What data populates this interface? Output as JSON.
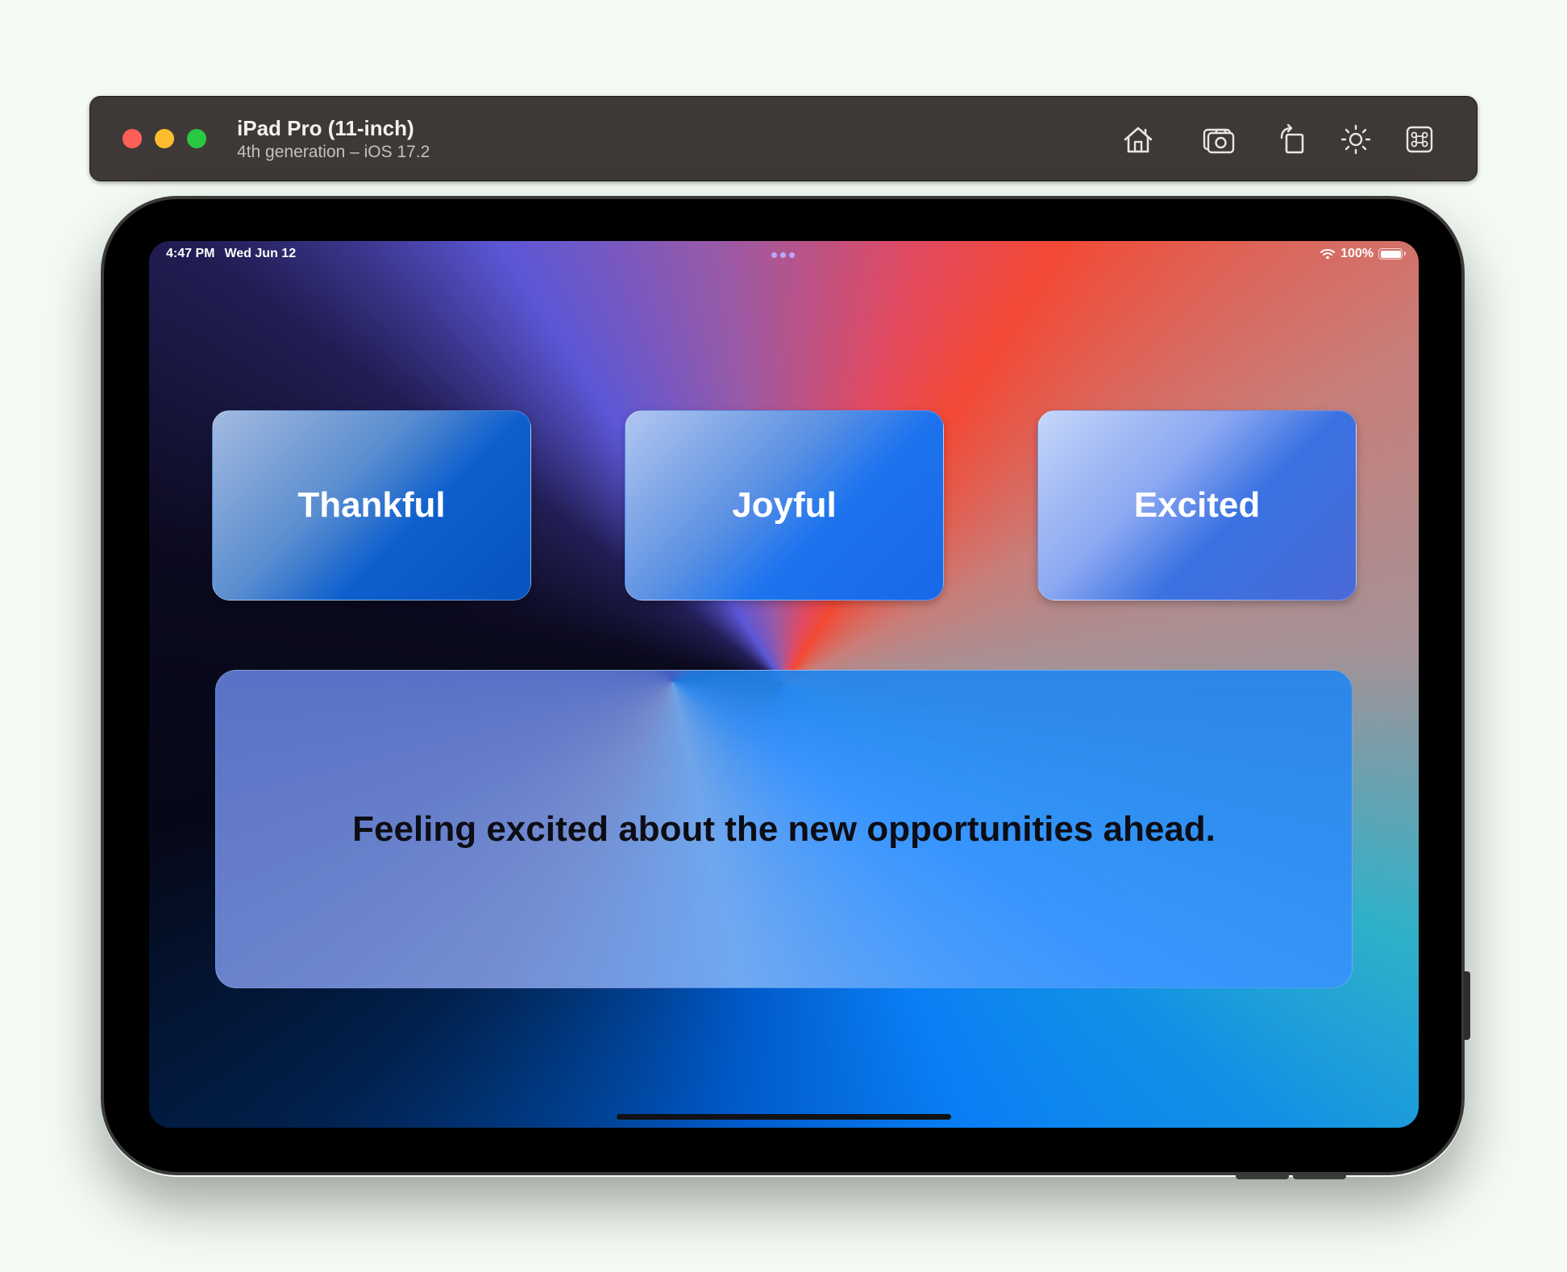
{
  "window": {
    "device_name": "iPad Pro (11-inch)",
    "device_subtitle": "4th generation – iOS 17.2",
    "toolbar_icons": [
      "home-icon",
      "screenshot-icon",
      "rotate-icon",
      "brightness-icon",
      "command-icon"
    ]
  },
  "status_bar": {
    "time": "4:47 PM",
    "date": "Wed Jun 12",
    "battery": "100%"
  },
  "moods": [
    {
      "label": "Thankful"
    },
    {
      "label": "Joyful"
    },
    {
      "label": "Excited"
    }
  ],
  "message": {
    "text": "Feeling excited about the new opportunities ahead."
  },
  "colors": {
    "window_bar": "#3e3936",
    "close": "#ff5f57",
    "minimize": "#febc2e",
    "maximize": "#28c840",
    "accent_blue": "#1868e8"
  }
}
